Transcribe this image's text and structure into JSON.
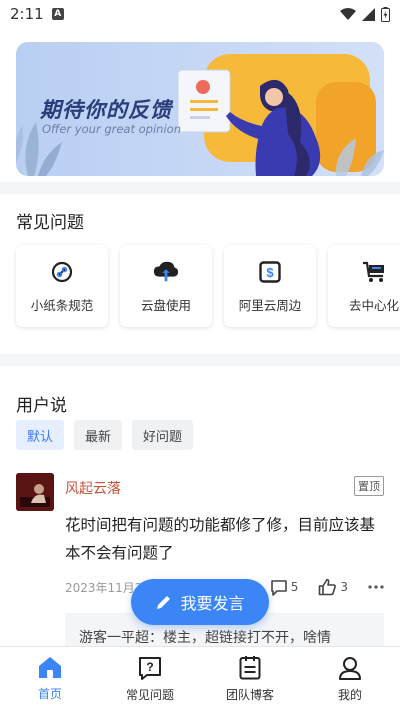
{
  "status_bar": {
    "time": "2:11",
    "notification_badge": "A"
  },
  "banner": {
    "title": "期待你的反馈",
    "subtitle": "Offer your great opinion"
  },
  "faq": {
    "title": "常见问题",
    "items": [
      {
        "label": "小纸条规范",
        "icon": "link-icon"
      },
      {
        "label": "云盘使用",
        "icon": "cloud-upload-icon"
      },
      {
        "label": "阿里云周边",
        "icon": "dollar-icon"
      },
      {
        "label": "去中心化",
        "icon": "cart-icon"
      }
    ]
  },
  "user_say": {
    "title": "用户说",
    "filters": [
      {
        "label": "默认",
        "active": true
      },
      {
        "label": "最新",
        "active": false
      },
      {
        "label": "好问题",
        "active": false
      }
    ]
  },
  "post": {
    "author": "风起云落",
    "pinned_label": "置顶",
    "body": "花时间把有问题的功能都修了修，目前应该基本不会有问题了",
    "timestamp": "2023年11月27日 15:16",
    "comments": "5",
    "likes": "3",
    "reply": "游客一平超：楼主，超链接打不开，啥情"
  },
  "fab": {
    "label": "我要发言"
  },
  "tabbar": {
    "items": [
      {
        "label": "首页",
        "icon": "home-icon",
        "active": true
      },
      {
        "label": "常见问题",
        "icon": "question-icon",
        "active": false
      },
      {
        "label": "团队博客",
        "icon": "document-icon",
        "active": false
      },
      {
        "label": "我的",
        "icon": "person-icon",
        "active": false
      }
    ]
  },
  "colors": {
    "accent": "#3b85f7",
    "author": "#c6553a",
    "chip_active_bg": "#e6efff"
  }
}
